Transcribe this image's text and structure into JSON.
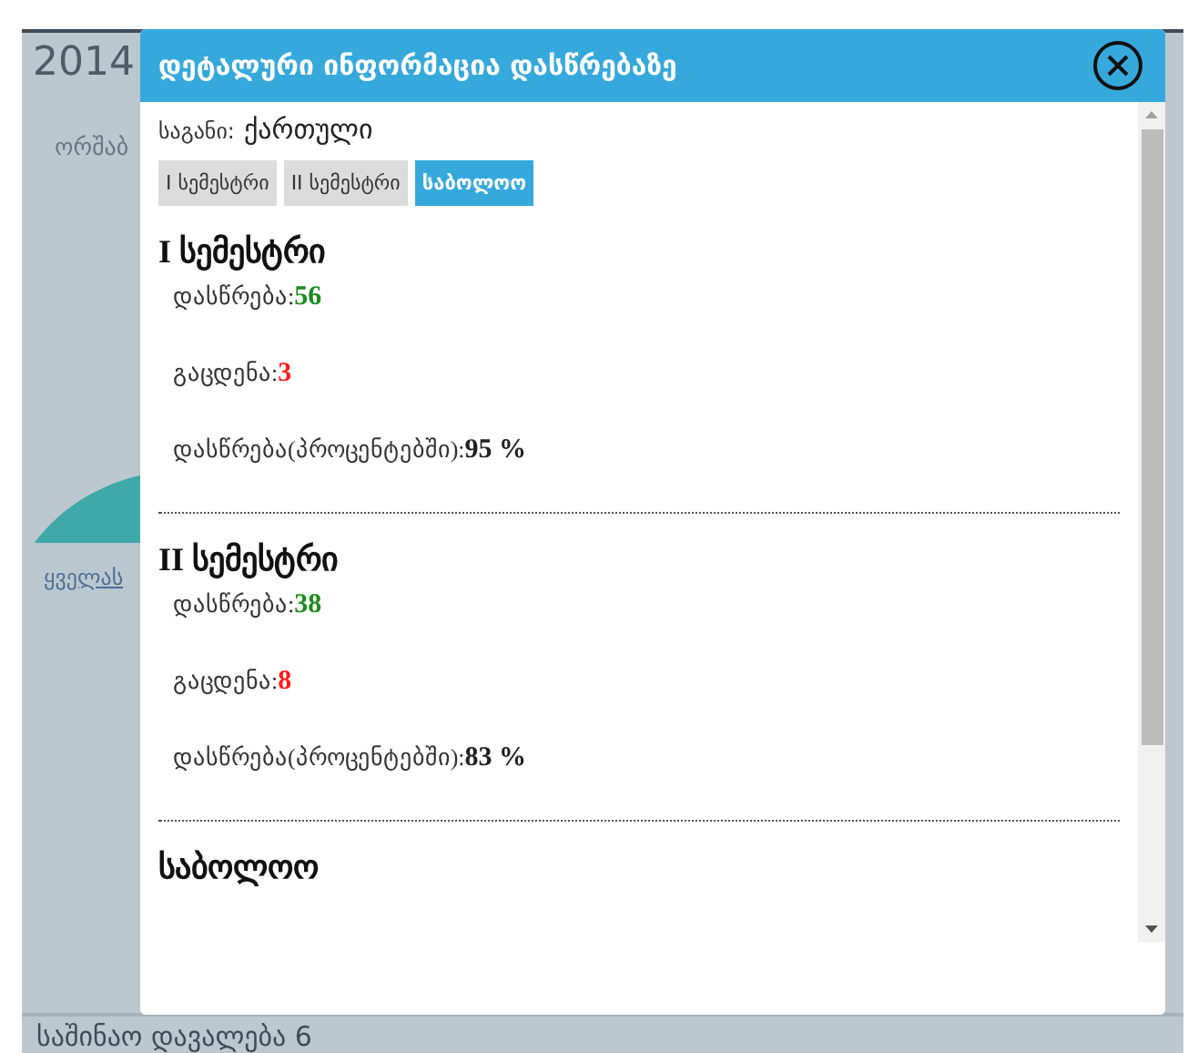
{
  "background": {
    "year": "2014",
    "day": "ორშაბ",
    "link": "ყველას",
    "footer_heading": "საშინაო დავალება 6"
  },
  "modal": {
    "title": "დეტალური ინფორმაცია დასწრებაზე",
    "subject_label": "საგანი:",
    "subject": "ქართული",
    "tabs": [
      {
        "label": "I სემესტრი",
        "selected": false
      },
      {
        "label": "II სემესტრი",
        "selected": false
      },
      {
        "label": "საბოლოო",
        "selected": true
      }
    ],
    "sections": [
      {
        "heading": "I სემესტრი",
        "stats": [
          {
            "kind": "present",
            "label": "დასწრება:",
            "value": "56"
          },
          {
            "kind": "absent",
            "label": "გაცდენა:",
            "value": "3"
          },
          {
            "kind": "percent",
            "label": "დასწრება(პროცენტებში):",
            "value": "95 %"
          }
        ]
      },
      {
        "heading": "II სემესტრი",
        "stats": [
          {
            "kind": "present",
            "label": "დასწრება:",
            "value": "38"
          },
          {
            "kind": "absent",
            "label": "გაცდენა:",
            "value": "8"
          },
          {
            "kind": "percent",
            "label": "დასწრება(პროცენტებში):",
            "value": "83 %"
          }
        ]
      },
      {
        "heading": "საბოლოო"
      }
    ]
  }
}
